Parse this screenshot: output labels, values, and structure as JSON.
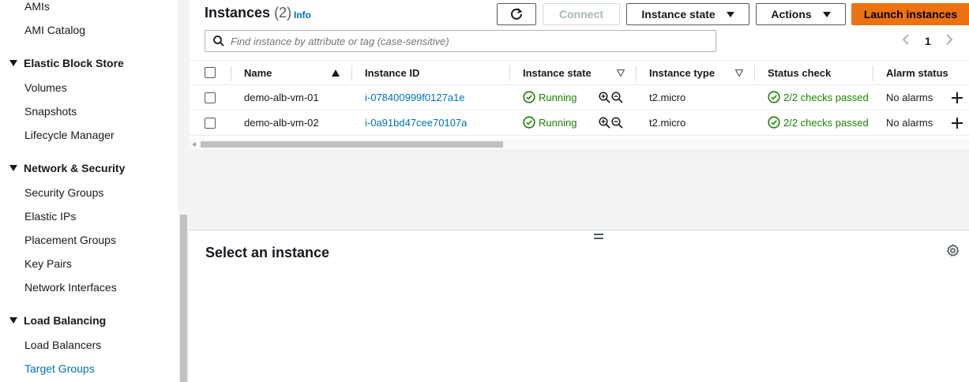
{
  "sidebar": {
    "items": [
      {
        "label": "AMIs"
      },
      {
        "label": "AMI Catalog"
      },
      {
        "section": "Elastic Block Store"
      },
      {
        "label": "Volumes"
      },
      {
        "label": "Snapshots"
      },
      {
        "label": "Lifecycle Manager"
      },
      {
        "section": "Network & Security"
      },
      {
        "label": "Security Groups"
      },
      {
        "label": "Elastic IPs"
      },
      {
        "label": "Placement Groups"
      },
      {
        "label": "Key Pairs"
      },
      {
        "label": "Network Interfaces"
      },
      {
        "section": "Load Balancing"
      },
      {
        "label": "Load Balancers"
      },
      {
        "label": "Target Groups"
      }
    ]
  },
  "header": {
    "title": "Instances",
    "count": "(2)",
    "info": "Info",
    "connect": "Connect",
    "instance_state": "Instance state",
    "actions": "Actions",
    "launch": "Launch instances"
  },
  "search": {
    "placeholder": "Find instance by attribute or tag (case-sensitive)"
  },
  "pager": {
    "page": "1"
  },
  "table": {
    "columns": [
      "Name",
      "Instance ID",
      "Instance state",
      "Instance type",
      "Status check",
      "Alarm status"
    ],
    "rows": [
      {
        "name": "demo-alb-vm-01",
        "id": "i-078400999f0127a1e",
        "state": "Running",
        "type": "t2.micro",
        "status": "2/2 checks passed",
        "alarm": "No alarms"
      },
      {
        "name": "demo-alb-vm-02",
        "id": "i-0a91bd47cee70107a",
        "state": "Running",
        "type": "t2.micro",
        "status": "2/2 checks passed",
        "alarm": "No alarms"
      }
    ]
  },
  "detail": {
    "title": "Select an instance"
  },
  "colors": {
    "accent": "#ec7211",
    "link": "#0073bb",
    "success": "#1d8102"
  }
}
